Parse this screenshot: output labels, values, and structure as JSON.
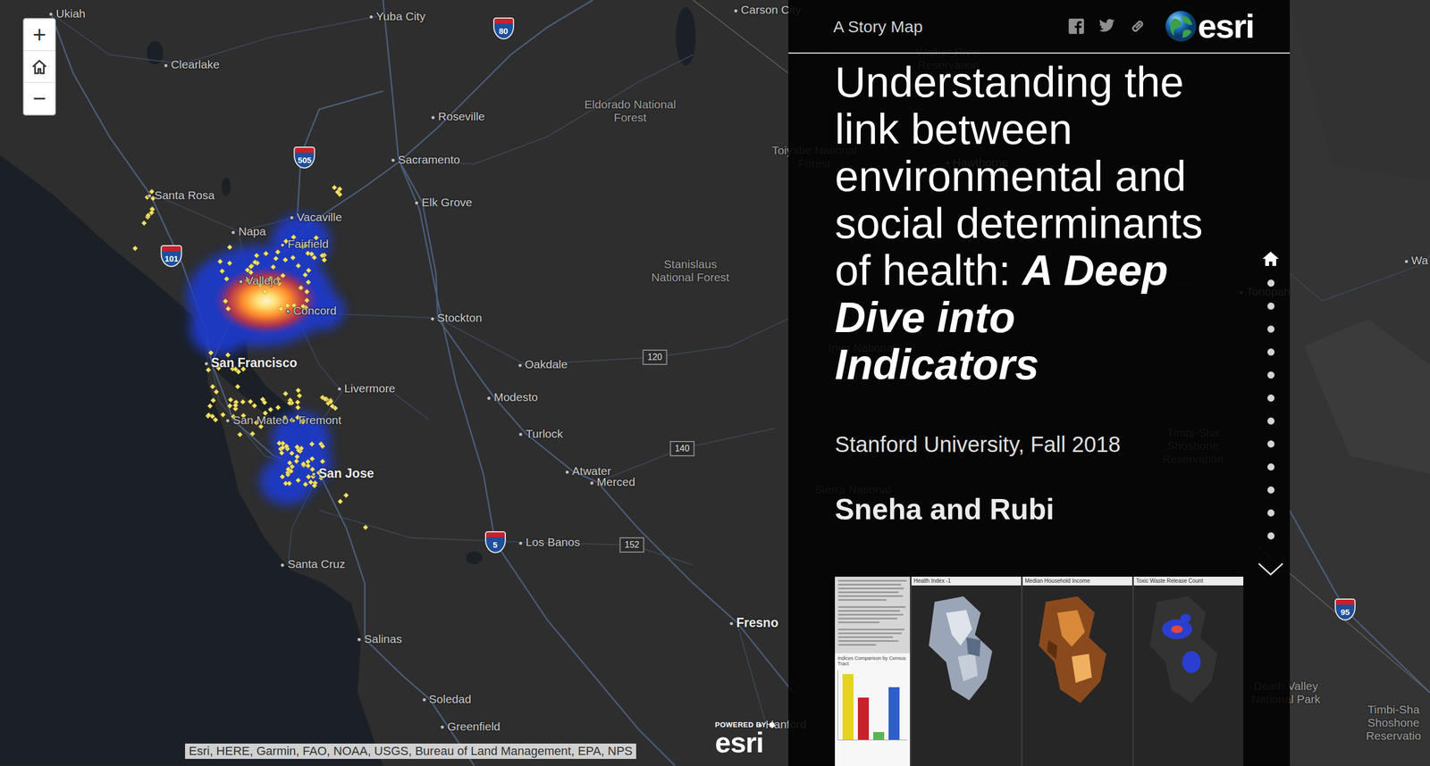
{
  "map": {
    "zoom_in": "+",
    "zoom_out": "−",
    "labels": [
      {
        "text": "Ukiah",
        "kind": "city"
      },
      {
        "text": "Yuba City",
        "kind": "city"
      },
      {
        "text": "Carson City",
        "kind": "city"
      },
      {
        "text": "Clearlake",
        "kind": "city"
      },
      {
        "text": "Eldorado National Forest",
        "kind": "area"
      },
      {
        "text": "Roseville",
        "kind": "city"
      },
      {
        "text": "Sacramento",
        "kind": "city"
      },
      {
        "text": "Elk Grove",
        "kind": "city"
      },
      {
        "text": "Santa Rosa",
        "kind": "city"
      },
      {
        "text": "Vacaville",
        "kind": "city"
      },
      {
        "text": "Napa",
        "kind": "city"
      },
      {
        "text": "Fairfield",
        "kind": "city"
      },
      {
        "text": "Vallejo",
        "kind": "city"
      },
      {
        "text": "Concord",
        "kind": "city"
      },
      {
        "text": "Stockton",
        "kind": "city"
      },
      {
        "text": "Stanislaus National Forest",
        "kind": "area"
      },
      {
        "text": "Oakdale",
        "kind": "city"
      },
      {
        "text": "San Francisco",
        "kind": "major"
      },
      {
        "text": "Livermore",
        "kind": "city"
      },
      {
        "text": "Modesto",
        "kind": "city"
      },
      {
        "text": "San Mateo",
        "kind": "city"
      },
      {
        "text": "Fremont",
        "kind": "city"
      },
      {
        "text": "Turlock",
        "kind": "city"
      },
      {
        "text": "San Jose",
        "kind": "major"
      },
      {
        "text": "Atwater",
        "kind": "city"
      },
      {
        "text": "Merced",
        "kind": "city"
      },
      {
        "text": "Los Banos",
        "kind": "city"
      },
      {
        "text": "Santa Cruz",
        "kind": "city"
      },
      {
        "text": "Fresno",
        "kind": "major"
      },
      {
        "text": "Salinas",
        "kind": "city"
      },
      {
        "text": "Soledad",
        "kind": "city"
      },
      {
        "text": "Greenfield",
        "kind": "city"
      },
      {
        "text": "Hanford",
        "kind": "city"
      },
      {
        "text": "Walker River Reservation",
        "kind": "area"
      },
      {
        "text": "Toiyabe National Forest",
        "kind": "area"
      },
      {
        "text": "Hawthorne",
        "kind": "city"
      },
      {
        "text": "Inyo National",
        "kind": "area"
      },
      {
        "text": "Sierra National",
        "kind": "area"
      },
      {
        "text": "Tonopah",
        "kind": "city"
      },
      {
        "text": "Timbi-Sha Shoshone Reservation",
        "kind": "area"
      },
      {
        "text": "Death Valley National Park",
        "kind": "area"
      },
      {
        "text": "Wa",
        "kind": "city"
      },
      {
        "text": "Timbi-Sha Shoshone Reservatio",
        "kind": "area"
      }
    ],
    "shields": [
      {
        "text": "80",
        "kind": "interstate"
      },
      {
        "text": "505",
        "kind": "interstate"
      },
      {
        "text": "101",
        "kind": "interstate"
      },
      {
        "text": "120",
        "kind": "state"
      },
      {
        "text": "140",
        "kind": "state"
      },
      {
        "text": "5",
        "kind": "interstate"
      },
      {
        "text": "152",
        "kind": "state"
      },
      {
        "text": "95",
        "kind": "interstate"
      }
    ],
    "attribution": "Esri, HERE, Garmin, FAO, NOAA, USGS, Bureau of Land Management, EPA, NPS",
    "powered_by": "POWERED BY",
    "powered_logo": "esri"
  },
  "story": {
    "kicker": "A Story Map",
    "logo": "esri",
    "title": "Understanding the link between environmental and social determinants of health: ",
    "title_emphasis": "A Deep Dive into Indicators",
    "subtitle": "Stanford University, Fall 2018",
    "authors": "Sneha and Rubi",
    "nav": [
      {
        "kind": "home",
        "selected": true
      },
      {
        "kind": "dot",
        "selected": false
      },
      {
        "kind": "dot",
        "selected": false
      },
      {
        "kind": "dot",
        "selected": false
      },
      {
        "kind": "dot",
        "selected": false
      },
      {
        "kind": "dot",
        "selected": false
      },
      {
        "kind": "dot",
        "selected": false
      },
      {
        "kind": "dot",
        "selected": false
      },
      {
        "kind": "dot",
        "selected": false
      },
      {
        "kind": "dot",
        "selected": false
      },
      {
        "kind": "dot",
        "selected": false
      },
      {
        "kind": "dot",
        "selected": false
      },
      {
        "kind": "dot",
        "selected": false
      }
    ],
    "thumbnail": {
      "chart": {
        "title": "Indices Comparison by Census Tract",
        "bars": [
          {
            "value": 88,
            "color": "#e5d31f"
          },
          {
            "value": 56,
            "color": "#c8222a"
          },
          {
            "value": 10,
            "color": "#5ab552"
          },
          {
            "value": 70,
            "color": "#2e5fc9"
          }
        ]
      },
      "maps": [
        {
          "title": "Health Index -1"
        },
        {
          "title": "Median Household Income"
        },
        {
          "title": "Toxic Waste Release Count"
        }
      ]
    }
  }
}
